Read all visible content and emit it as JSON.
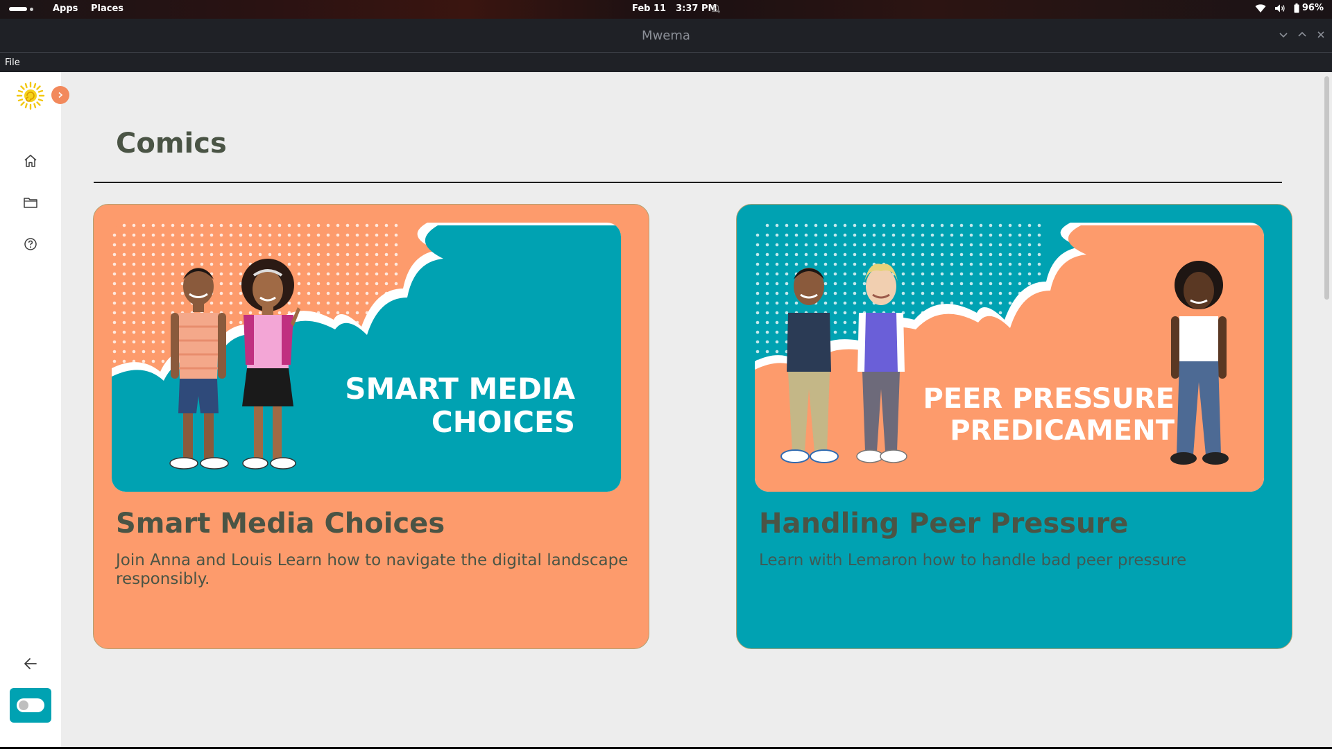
{
  "system_bar": {
    "apps_label": "Apps",
    "places_label": "Places",
    "date": "Feb 11",
    "time": "3:37 PM",
    "battery": "96%"
  },
  "window": {
    "title": "Mwema"
  },
  "menu": {
    "file_label": "File"
  },
  "page": {
    "title": "Comics"
  },
  "cards": [
    {
      "title": "Smart Media Choices",
      "description": "Join Anna and Louis Learn how to navigate the digital landscape responsibly.",
      "banner_line1": "SMART MEDIA",
      "banner_line2": "CHOICES",
      "background_color": "#fd9b6c"
    },
    {
      "title": "Handling Peer Pressure",
      "description": "Learn with Lemaron how to handle bad peer pressure",
      "banner_line1": "PEER PRESSURE",
      "banner_line2": "PREDICAMENT",
      "background_color": "#00a2b2"
    }
  ],
  "colors": {
    "accent_orange": "#fd9b6c",
    "accent_teal": "#00a2b2",
    "text_dark": "#4a5445"
  }
}
